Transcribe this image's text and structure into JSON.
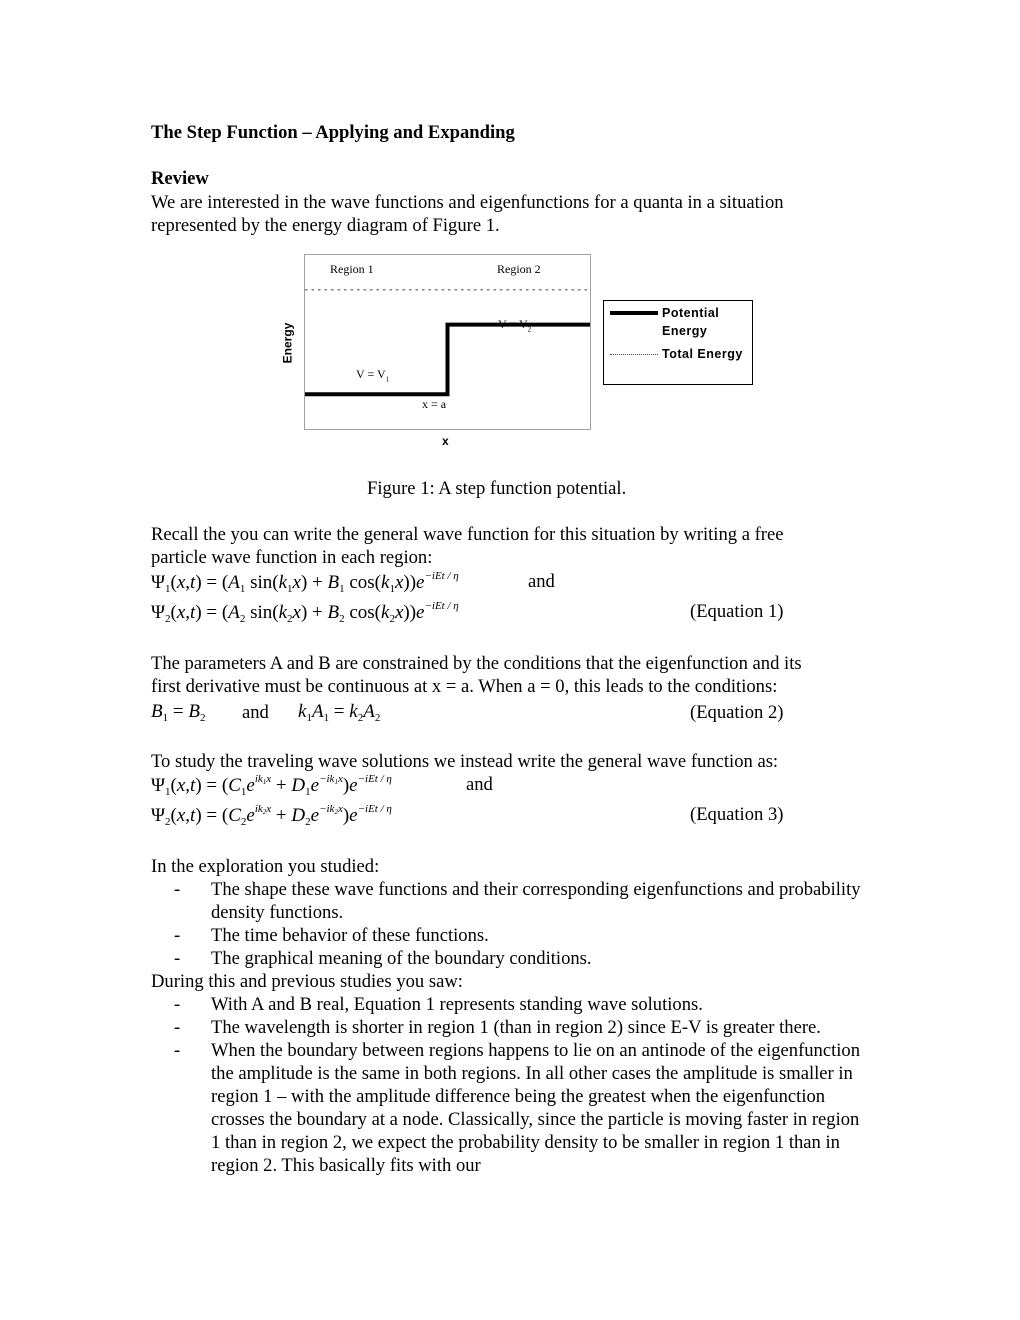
{
  "title": "The Step Function – Applying and Expanding",
  "review_heading": "Review",
  "review_lines": [
    "We are interested in the wave functions and eigenfunctions for a quanta in a situation",
    "represented by the energy diagram of Figure 1."
  ],
  "figure": {
    "caption": "Figure 1:  A step function potential.",
    "region1_label": "Region 1",
    "region2_label": "Region 2",
    "v1_label": "V = V",
    "v1_sub": "1",
    "v2_label": "V = V",
    "v2_sub": "2",
    "xa_label": "x = a",
    "xlabel": "x",
    "ylabel": "Energy",
    "legend": {
      "potential_line1": "Potential",
      "potential_line2": "Energy",
      "total": "Total Energy"
    }
  },
  "chart_data": {
    "type": "line",
    "title": "",
    "xlabel": "x",
    "ylabel": "Energy",
    "legend_placement": "right",
    "grid": false,
    "series": [
      {
        "name": "Potential Energy",
        "style": "solid-thick",
        "x": [
          0,
          0.5,
          0.5,
          1
        ],
        "y": [
          0.2,
          0.2,
          0.6,
          0.6
        ]
      },
      {
        "name": "Total Energy",
        "style": "dotted",
        "x": [
          0,
          1
        ],
        "y": [
          0.8,
          0.8
        ]
      }
    ],
    "xlim": [
      0,
      1
    ],
    "ylim": [
      0,
      1
    ],
    "annotations": [
      "Region 1",
      "Region 2",
      "V = V1",
      "V = V2",
      "x = a"
    ]
  },
  "recall_lines": [
    "Recall the you can write the general wave function for this situation by writing a free",
    "particle wave function in each region:"
  ],
  "and_label": "and",
  "eq1_label": "(Equation 1)",
  "params_lines": [
    "The parameters A and B are constrained by the conditions that the eigenfunction and its",
    "first derivative must be continuous at x = a.  When a = 0, this leads to the conditions:"
  ],
  "eq2_label": "(Equation 2)",
  "traveling_line": "To study the traveling wave solutions we instead write the general wave function as:",
  "eq3_label": "(Equation 3)",
  "exploration_heading": "In the exploration you studied:",
  "exploration_items": [
    "The shape these wave functions and their corresponding eigenfunctions and probability density functions.",
    "The time behavior of these functions.",
    "The graphical meaning of the boundary conditions."
  ],
  "during_heading": "During this and previous studies you saw:",
  "during_items": [
    "With A and B real, Equation 1 represents standing wave solutions.",
    "The wavelength is shorter in region 1 (than in region 2) since E-V is greater there.",
    "When the boundary between regions happens to lie on an antinode of the eigenfunction the amplitude is the same in both regions.  In all other cases the amplitude is smaller in region 1 – with the amplitude difference being the greatest when the eigenfunction crosses the boundary at a node.  Classically, since the particle is moving faster in region 1 than in region 2, we expect the probability density to be smaller in region 1 than in region 2.  This basically fits with our"
  ]
}
